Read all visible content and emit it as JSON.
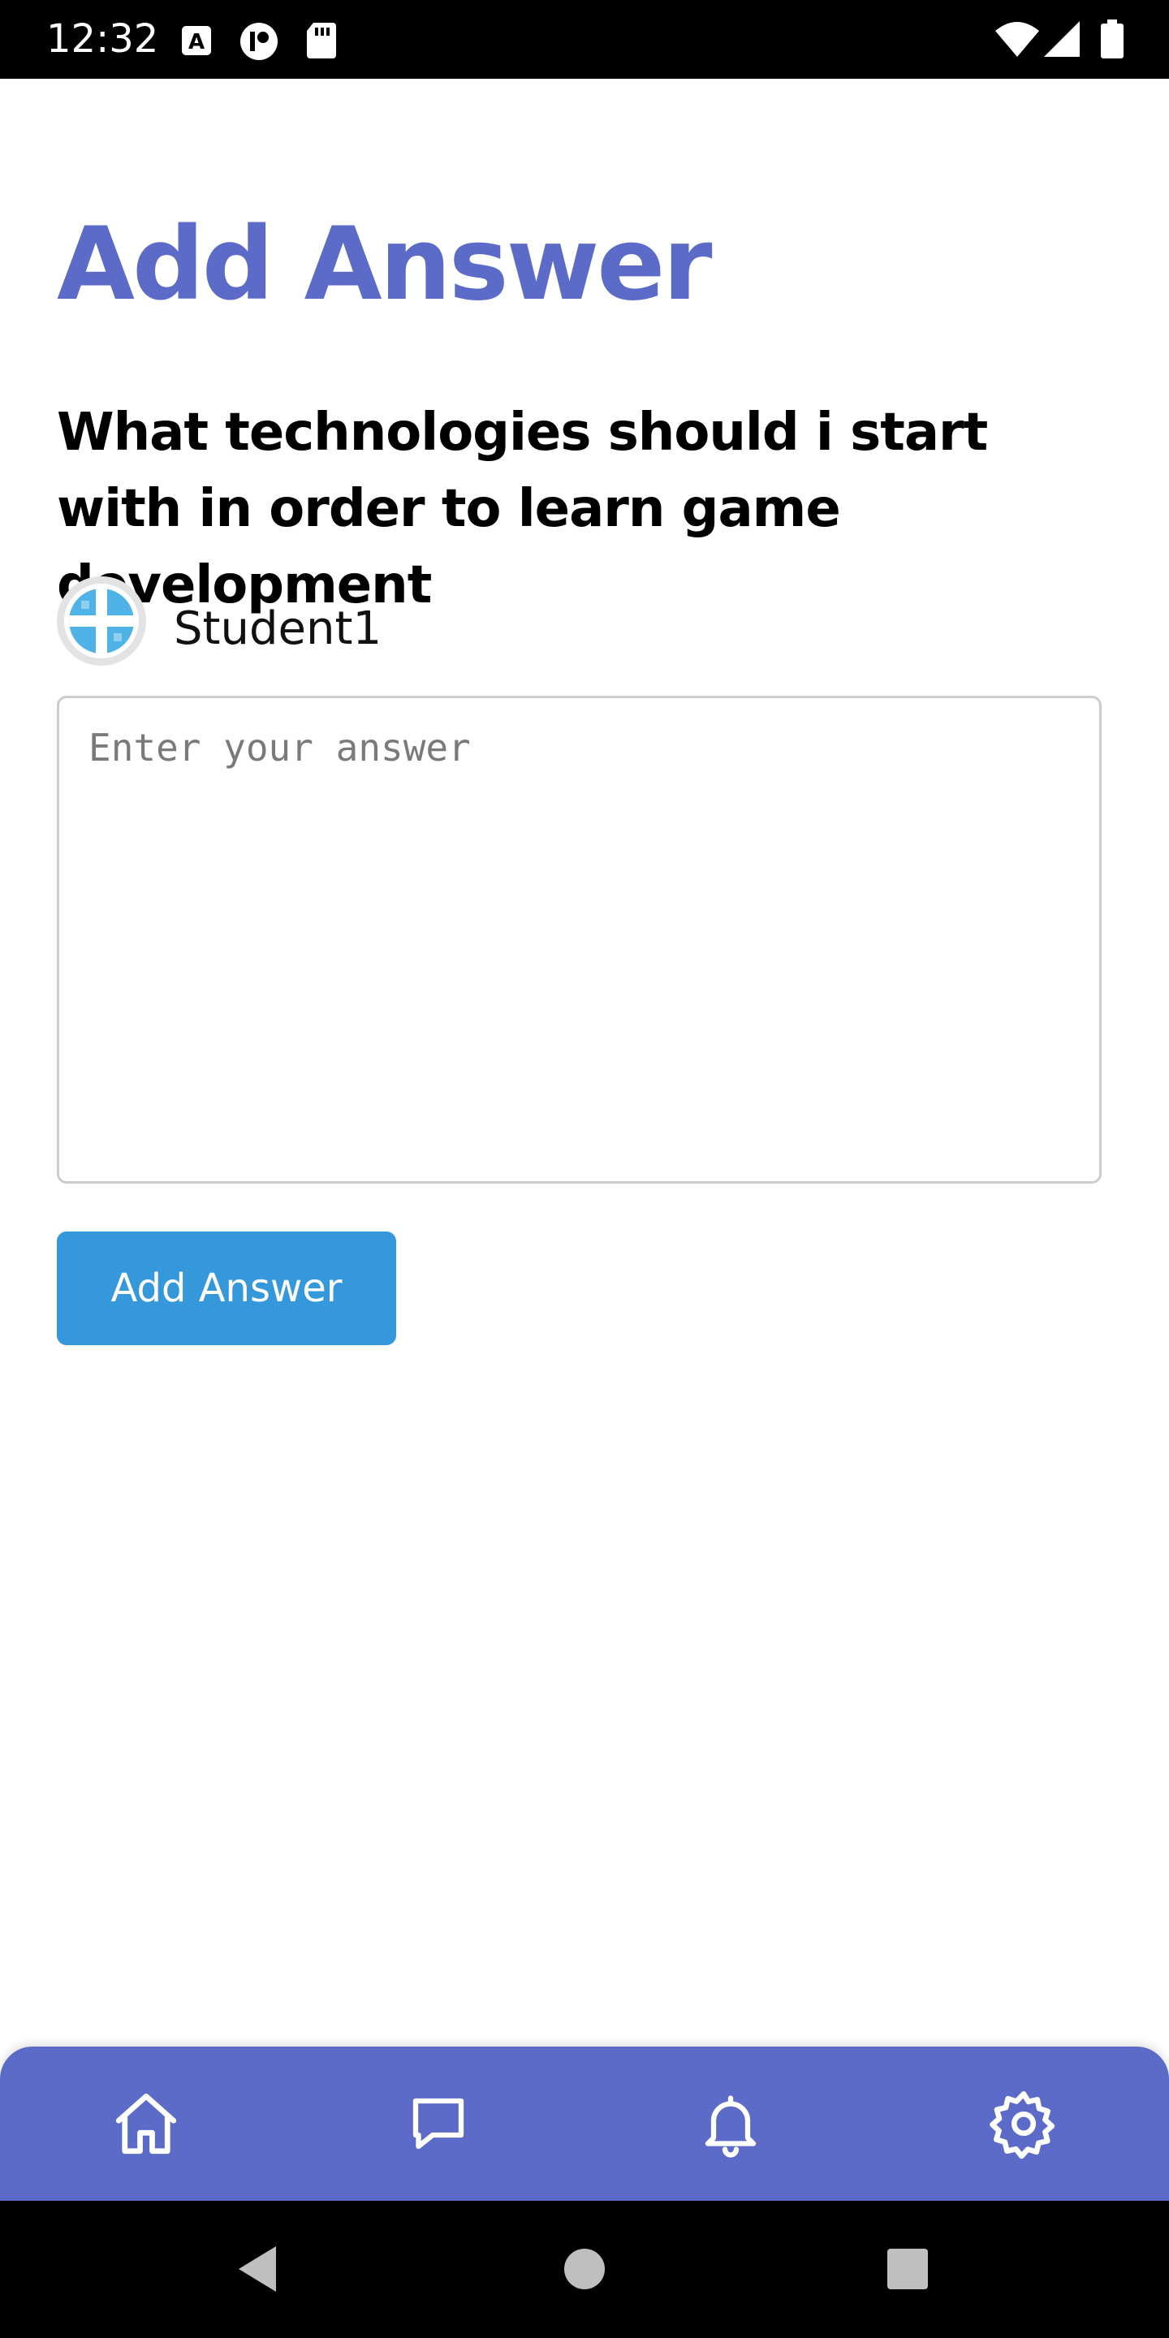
{
  "status_bar": {
    "time": "12:32",
    "left_icons": [
      "a-badge-icon",
      "circle-app-icon",
      "sd-card-icon"
    ],
    "right_icons": [
      "wifi-icon",
      "signal-icon",
      "battery-icon"
    ]
  },
  "page": {
    "title": "Add Answer",
    "question": "What technologies should i start with in order to learn game development",
    "author": {
      "name": "Student1",
      "avatar_icon": "avatar-icon"
    },
    "answer_input": {
      "value": "",
      "placeholder": "Enter your answer"
    },
    "submit_label": "Add Answer"
  },
  "bottom_nav": {
    "items": [
      {
        "icon": "home-icon"
      },
      {
        "icon": "chat-icon"
      },
      {
        "icon": "bell-icon"
      },
      {
        "icon": "settings-icon"
      }
    ]
  },
  "system_nav": {
    "buttons": [
      "back-icon",
      "home-circle-icon",
      "recents-icon"
    ]
  },
  "colors": {
    "accent": "#5c6bc8",
    "button": "#3498db",
    "status_bar": "#000000",
    "nav_background": "#5c6bc8"
  }
}
